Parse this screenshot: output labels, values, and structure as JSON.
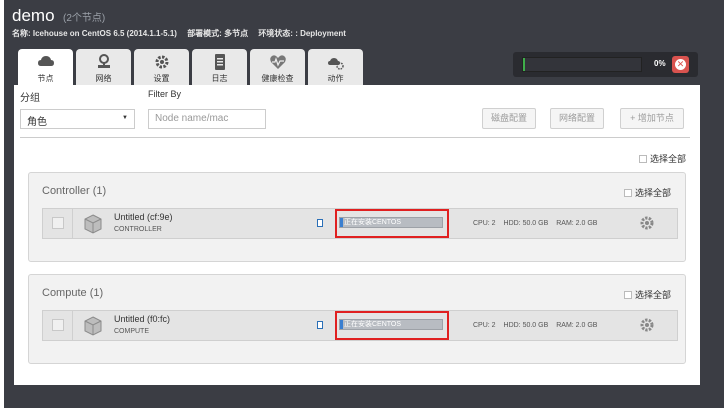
{
  "env": {
    "name": "demo",
    "node_count": "(2个节点)",
    "name_label": "名称: Icehouse on CentOS 6.5 (2014.1.1-5.1)",
    "mode_label": "部署模式: 多节点",
    "status_label": "环境状态: : Deployment"
  },
  "tabs": [
    {
      "label": "节点",
      "icon": "cloud-icon"
    },
    {
      "label": "网络",
      "icon": "network-icon"
    },
    {
      "label": "设置",
      "icon": "gear-icon"
    },
    {
      "label": "日志",
      "icon": "log-icon"
    },
    {
      "label": "健康检查",
      "icon": "heartbeat-icon"
    },
    {
      "label": "动作",
      "icon": "actions-icon"
    }
  ],
  "deployment": {
    "progress": 0.02,
    "percent_label": "0%"
  },
  "filters": {
    "group_label": "分组",
    "group_value": "角色",
    "filter_label": "Filter By",
    "filter_placeholder": "Node name/mac"
  },
  "buttons": {
    "disk_config": "磁盘配置",
    "network_config": "网络配置",
    "add_nodes": "+ 增加节点"
  },
  "select_all": "选择全部",
  "groups": [
    {
      "title": "Controller (1)",
      "node": {
        "name": "Untitled (cf:9e)",
        "role": "CONTROLLER",
        "status": "正在安装CENTOS",
        "progress": 0.03,
        "cpu": "CPU: 2",
        "hdd": "HDD: 50.0 GB",
        "ram": "RAM: 2.0 GB"
      }
    },
    {
      "title": "Compute (1)",
      "node": {
        "name": "Untitled (f0:fc)",
        "role": "COMPUTE",
        "status": "正在安装CENTOS",
        "progress": 0.03,
        "cpu": "CPU: 2",
        "hdd": "HDD: 50.0 GB",
        "ram": "RAM: 2.0 GB"
      }
    }
  ],
  "colors": {
    "header_bg": "#3b3d44",
    "progress_green": "#3fae4a",
    "stop_red": "#d9534f",
    "status_blue": "#3a7fd0",
    "highlight_red": "#e02020"
  }
}
